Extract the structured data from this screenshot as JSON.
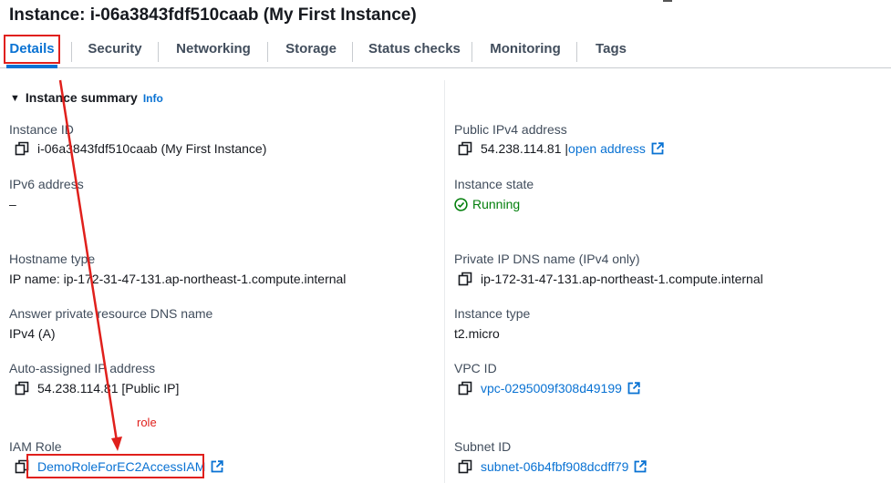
{
  "page": {
    "title": "Instance: i-06a3843fdf510caab (My First Instance)"
  },
  "tabs": [
    {
      "label": "Details",
      "active": true
    },
    {
      "label": "Security",
      "active": false
    },
    {
      "label": "Networking",
      "active": false
    },
    {
      "label": "Storage",
      "active": false
    },
    {
      "label": "Status checks",
      "active": false
    },
    {
      "label": "Monitoring",
      "active": false
    },
    {
      "label": "Tags",
      "active": false
    }
  ],
  "summary": {
    "heading": "Instance summary",
    "info_link": "Info"
  },
  "fields": {
    "instance_id": {
      "label": "Instance ID",
      "value": "i-06a3843fdf510caab (My First Instance)"
    },
    "ipv6_address": {
      "label": "IPv6 address",
      "value": "–"
    },
    "hostname_type": {
      "label": "Hostname type",
      "value": "IP name: ip-172-31-47-131.ap-northeast-1.compute.internal"
    },
    "answer_dns": {
      "label": "Answer private resource DNS name",
      "value": "IPv4 (A)"
    },
    "auto_ip": {
      "label": "Auto-assigned IP address",
      "value": "54.238.114.81 [Public IP]"
    },
    "iam_role": {
      "label": "IAM Role",
      "value": "DemoRoleForEC2AccessIAM"
    },
    "public_ipv4": {
      "label": "Public IPv4 address",
      "value": "54.238.114.81 |",
      "link": "open address"
    },
    "instance_state": {
      "label": "Instance state",
      "value": "Running"
    },
    "private_dns": {
      "label": "Private IP DNS name (IPv4 only)",
      "value": "ip-172-31-47-131.ap-northeast-1.compute.internal"
    },
    "instance_type": {
      "label": "Instance type",
      "value": "t2.micro"
    },
    "vpc_id": {
      "label": "VPC ID",
      "value": "vpc-0295009f308d49199"
    },
    "subnet_id": {
      "label": "Subnet ID",
      "value": "subnet-06b4fbf908dcdff79"
    }
  },
  "annotations": {
    "role_note": "role",
    "color": "#e0201c"
  },
  "icons": {
    "copy": "copy-icon",
    "external": "external-link-icon",
    "status": "check-circle-icon",
    "caret": "caret-down-icon"
  },
  "colors": {
    "link": "#0972d3",
    "running": "#037f0c",
    "annotation": "#e0201c"
  }
}
